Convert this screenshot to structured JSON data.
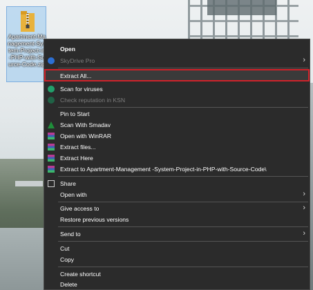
{
  "desktop": {
    "selected_icon_label": "Apartment-Management-System-Project-in-PHP-with-Source-Code.zip"
  },
  "menu": {
    "items": [
      {
        "label": "Open",
        "style": "bold"
      },
      {
        "label": "SkyDrive Pro",
        "disabled": true,
        "icon": "cloud-icon",
        "submenu": true
      },
      {
        "label": "Extract All...",
        "highlighted": true
      },
      {
        "label": "Scan for viruses",
        "icon": "shield-check-icon"
      },
      {
        "label": "Check reputation in KSN",
        "disabled": true,
        "icon": "shield-check-icon"
      },
      {
        "label": "Pin to Start"
      },
      {
        "label": "Scan With Smadav",
        "icon": "smadav-icon"
      },
      {
        "label": "Open with WinRAR",
        "icon": "winrar-icon"
      },
      {
        "label": "Extract files...",
        "icon": "winrar-icon"
      },
      {
        "label": "Extract Here",
        "icon": "winrar-icon"
      },
      {
        "label": "Extract to Apartment-Management -System-Project-in-PHP-with-Source-Code\\",
        "icon": "winrar-icon"
      },
      {
        "label": "Share",
        "icon": "share-icon"
      },
      {
        "label": "Open with",
        "submenu": true
      },
      {
        "label": "Give access to",
        "submenu": true
      },
      {
        "label": "Restore previous versions"
      },
      {
        "label": "Send to",
        "submenu": true
      },
      {
        "label": "Cut"
      },
      {
        "label": "Copy"
      },
      {
        "label": "Create shortcut"
      },
      {
        "label": "Delete"
      }
    ],
    "submenu_arrow": "›"
  },
  "colors": {
    "menu_bg": "#2b2b2b",
    "highlight_border": "#d0222a",
    "selection": "#99c9ef"
  }
}
